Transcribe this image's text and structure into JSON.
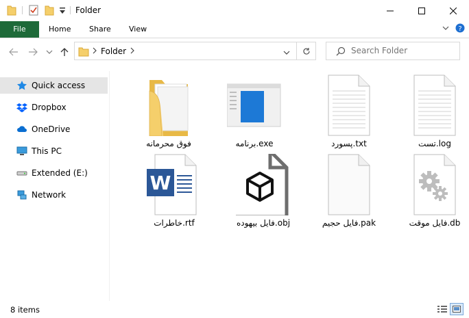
{
  "window": {
    "title": "Folder",
    "minimize": "—",
    "maximize": "☐",
    "close": "✕"
  },
  "ribbon": {
    "tabs": [
      "File",
      "Home",
      "Share",
      "View"
    ],
    "expand": "⌄",
    "help": "?"
  },
  "address": {
    "path": [
      "Folder"
    ],
    "search_placeholder": "Search Folder"
  },
  "nav": {
    "items": [
      {
        "label": "Quick access",
        "icon": "star-icon"
      },
      {
        "label": "Dropbox",
        "icon": "dropbox-icon"
      },
      {
        "label": "OneDrive",
        "icon": "cloud-icon"
      },
      {
        "label": "This PC",
        "icon": "monitor-icon"
      },
      {
        "label": "Extended (E:)",
        "icon": "drive-icon"
      },
      {
        "label": "Network",
        "icon": "network-icon"
      }
    ]
  },
  "files": [
    {
      "name": "فوق محرمانه",
      "type": "folder"
    },
    {
      "name": "برنامه.exe",
      "type": "exe"
    },
    {
      "name": "پسورد.txt",
      "type": "text"
    },
    {
      "name": "تست.log",
      "type": "text"
    },
    {
      "name": "خاطرات.rtf",
      "type": "word"
    },
    {
      "name": "فایل بیهوده.obj",
      "type": "obj"
    },
    {
      "name": "فایل حجیم.pak",
      "type": "blank"
    },
    {
      "name": "فایل موقت.db",
      "type": "db"
    }
  ],
  "status": {
    "count": "8 items"
  },
  "colors": {
    "file_tab": "#1e6a39",
    "folder": "#f5cf6b",
    "word": "#2b5797",
    "accent": "#0078d7"
  }
}
